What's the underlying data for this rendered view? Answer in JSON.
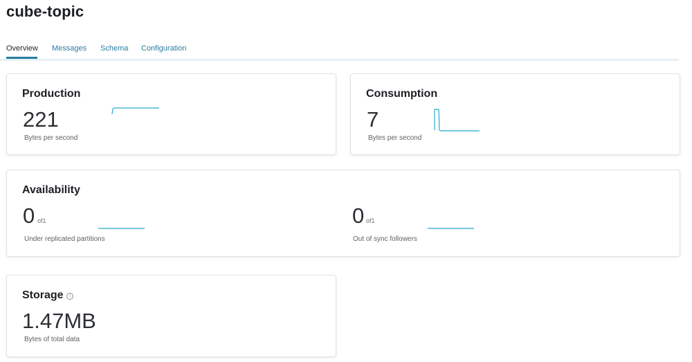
{
  "page": {
    "title": "cube-topic"
  },
  "tabs": [
    {
      "label": "Overview",
      "active": true
    },
    {
      "label": "Messages",
      "active": false
    },
    {
      "label": "Schema",
      "active": false
    },
    {
      "label": "Configuration",
      "active": false
    }
  ],
  "production": {
    "title": "Production",
    "value": "221",
    "unit_label": "Bytes per second"
  },
  "consumption": {
    "title": "Consumption",
    "value": "7",
    "unit_label": "Bytes per second"
  },
  "availability": {
    "title": "Availability",
    "under_replicated": {
      "value": "0",
      "of": "of1",
      "label": "Under replicated partitions"
    },
    "out_of_sync": {
      "value": "0",
      "of": "of1",
      "label": "Out of sync followers"
    }
  },
  "storage": {
    "title": "Storage",
    "info_icon": "info-circle-icon",
    "value": "1.47MB",
    "label": "Bytes of total data"
  },
  "colors": {
    "accent": "#2a7ca1",
    "sparkline": "#29a9c9"
  }
}
